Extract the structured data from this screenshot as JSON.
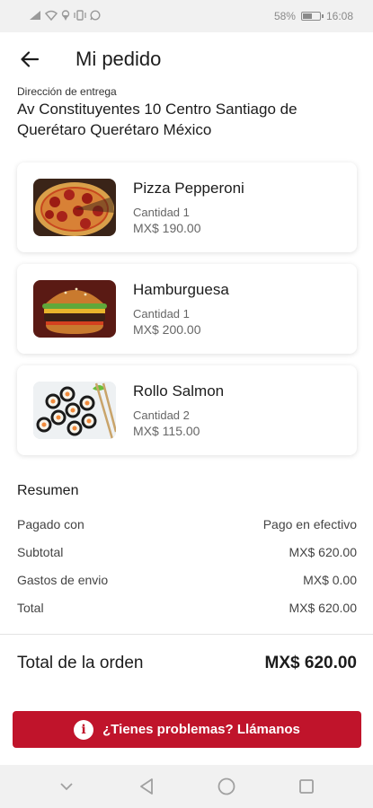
{
  "status_bar": {
    "battery_percent": "58%",
    "battery_level": 0.58,
    "time": "16:08",
    "icons": [
      "signal-icon",
      "wifi-icon",
      "location-icon",
      "vibrate-icon",
      "whatsapp-icon"
    ]
  },
  "header": {
    "title": "Mi pedido",
    "back_icon": "arrow-left-icon"
  },
  "address": {
    "label": "Dirección de entrega",
    "value": "Av Constituyentes 10 Centro Santiago de Querétaro Querétaro México"
  },
  "items": [
    {
      "name": "Pizza Pepperoni",
      "quantity": "Cantidad 1",
      "price": "MX$ 190.00",
      "image": "pizza-image"
    },
    {
      "name": "Hamburguesa",
      "quantity": "Cantidad 1",
      "price": "MX$ 200.00",
      "image": "burger-image"
    },
    {
      "name": "Rollo Salmon",
      "quantity": "Cantidad 2",
      "price": "MX$ 115.00",
      "image": "sushi-image"
    }
  ],
  "summary": {
    "title": "Resumen",
    "rows": [
      {
        "label": "Pagado con",
        "value": "Pago en efectivo"
      },
      {
        "label": "Subtotal",
        "value": "MX$ 620.00"
      },
      {
        "label": "Gastos de envio",
        "value": "MX$ 0.00"
      },
      {
        "label": "Total",
        "value": "MX$ 620.00"
      }
    ]
  },
  "order_total": {
    "label": "Total de la orden",
    "value": "MX$ 620.00"
  },
  "help_button": {
    "label": "¿Tienes problemas? Llámanos",
    "icon": "info-icon",
    "color": "#c0142b"
  },
  "nav": {
    "icons": [
      "chevron-down-icon",
      "back-triangle-icon",
      "home-circle-icon",
      "recents-square-icon"
    ]
  }
}
